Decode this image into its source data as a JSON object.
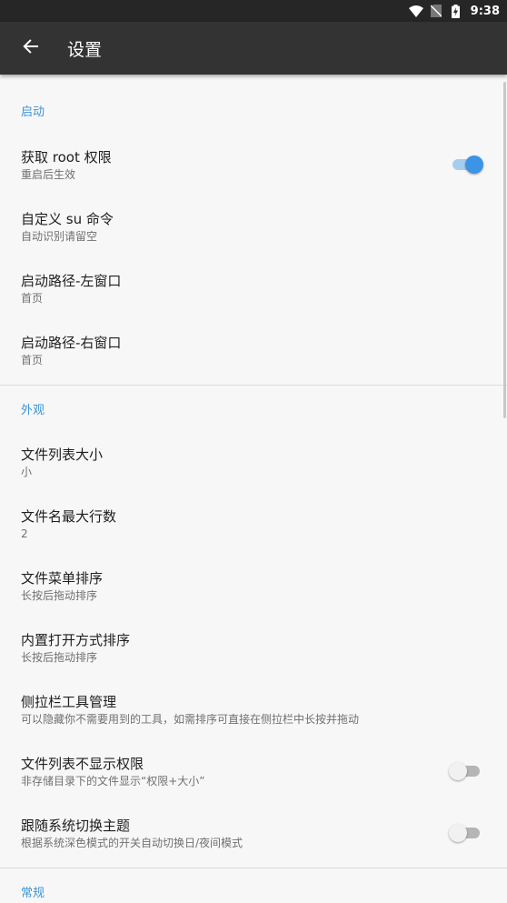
{
  "status_bar": {
    "time": "9:38"
  },
  "app_bar": {
    "title": "设置"
  },
  "sections": {
    "startup": {
      "header": "启动",
      "root": {
        "title": "获取 root 权限",
        "summary": "重启后生效",
        "enabled": true
      },
      "su": {
        "title": "自定义 su 命令",
        "summary": "自动识别请留空"
      },
      "left_path": {
        "title": "启动路径-左窗口",
        "summary": "首页"
      },
      "right_path": {
        "title": "启动路径-右窗口",
        "summary": "首页"
      }
    },
    "appearance": {
      "header": "外观",
      "list_size": {
        "title": "文件列表大小",
        "summary": "小"
      },
      "max_lines": {
        "title": "文件名最大行数",
        "summary": "2"
      },
      "menu_sort": {
        "title": "文件菜单排序",
        "summary": "长按后拖动排序"
      },
      "open_sort": {
        "title": "内置打开方式排序",
        "summary": "长按后拖动排序"
      },
      "sidebar_tools": {
        "title": "侧拉栏工具管理",
        "summary": "可以隐藏你不需要用到的工具，如需排序可直接在侧拉栏中长按并拖动"
      },
      "hide_perm": {
        "title": "文件列表不显示权限",
        "summary": "非存储目录下的文件显示“权限+大小”",
        "enabled": false
      },
      "follow_theme": {
        "title": "跟随系统切换主题",
        "summary": "根据系统深色模式的开关自动切换日/夜间模式",
        "enabled": false
      }
    },
    "general": {
      "header": "常规"
    }
  },
  "colors": {
    "accent": "#3d94d6",
    "app_bar": "#333333",
    "status_bar": "#262626",
    "background": "#f7f7f7"
  }
}
